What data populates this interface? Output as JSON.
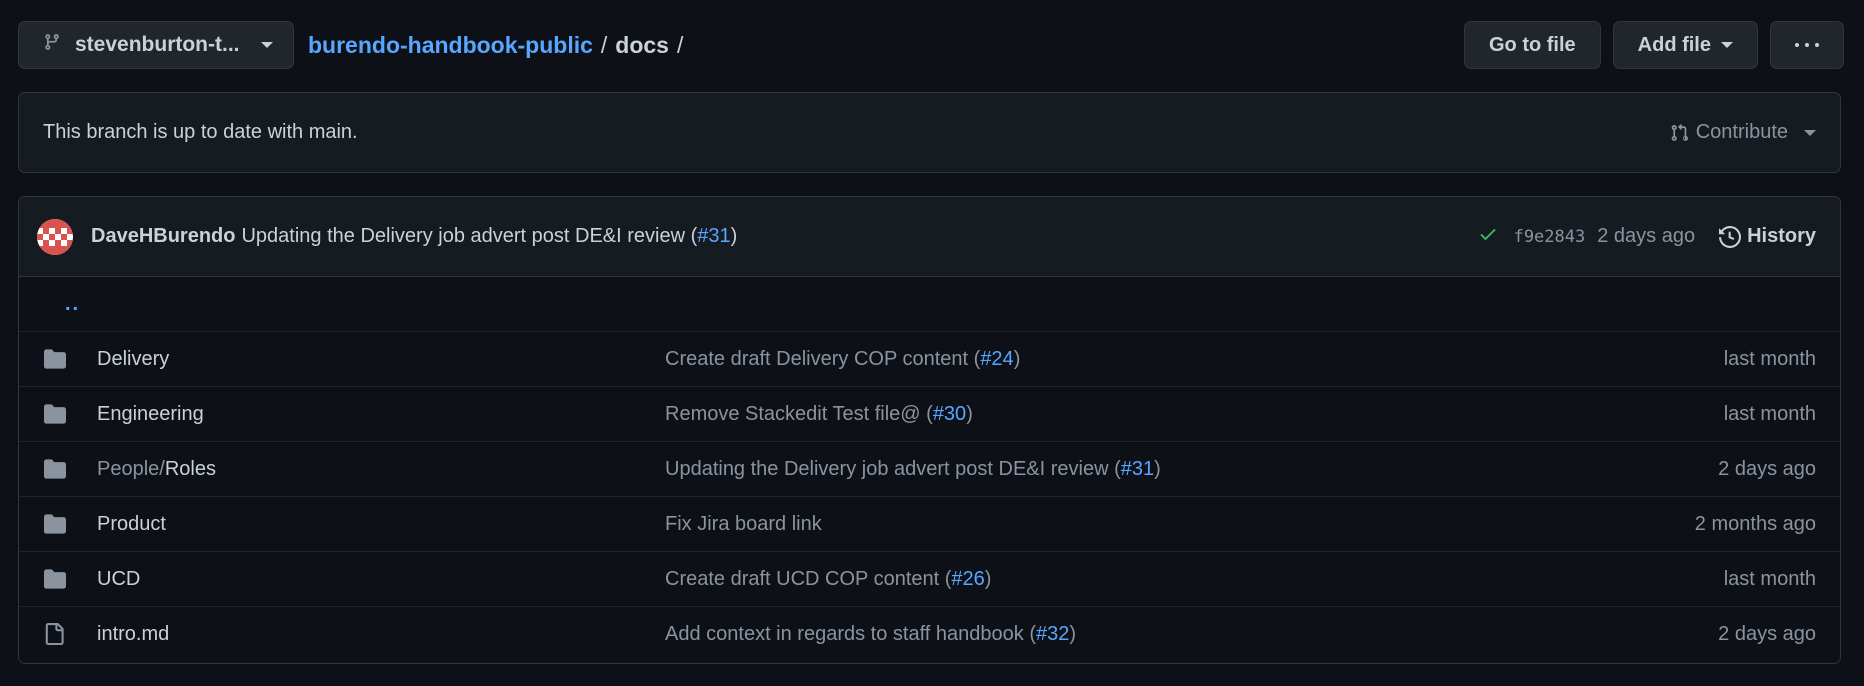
{
  "toolbar": {
    "branch_label": "stevenburton-t...",
    "repo_name": "burendo-handbook-public",
    "path_dir": "docs",
    "sep": "/",
    "go_to_file": "Go to file",
    "add_file": "Add file"
  },
  "status": {
    "text": "This branch is up to date with main.",
    "contribute": "Contribute"
  },
  "latest_commit": {
    "author": "DaveHBurendo",
    "message": "Updating the Delivery job advert post DE&I review (",
    "pr": "#31",
    "message_end": ")",
    "sha": "f9e2843",
    "time": "2 days ago",
    "history": "History"
  },
  "parent_dir": "..",
  "files": [
    {
      "type": "dir",
      "prefix": "",
      "name": "Delivery",
      "msg": "Create draft Delivery COP content (",
      "pr": "#24",
      "msg_end": ")",
      "age": "last month"
    },
    {
      "type": "dir",
      "prefix": "",
      "name": "Engineering",
      "msg": "Remove Stackedit Test file@ (",
      "pr": "#30",
      "msg_end": ")",
      "age": "last month"
    },
    {
      "type": "dir",
      "prefix": "People/",
      "name": "Roles",
      "msg": "Updating the Delivery job advert post DE&I review (",
      "pr": "#31",
      "msg_end": ")",
      "age": "2 days ago"
    },
    {
      "type": "dir",
      "prefix": "",
      "name": "Product",
      "msg": "Fix Jira board link",
      "pr": "",
      "msg_end": "",
      "age": "2 months ago"
    },
    {
      "type": "dir",
      "prefix": "",
      "name": "UCD",
      "msg": "Create draft UCD COP content (",
      "pr": "#26",
      "msg_end": ")",
      "age": "last month"
    },
    {
      "type": "file",
      "prefix": "",
      "name": "intro.md",
      "msg": "Add context in regards to staff handbook (",
      "pr": "#32",
      "msg_end": ")",
      "age": "2 days ago"
    }
  ],
  "colors": {
    "background": "#0d1117",
    "link": "#58a6ff",
    "success": "#3fb950",
    "muted": "#8b949e"
  }
}
